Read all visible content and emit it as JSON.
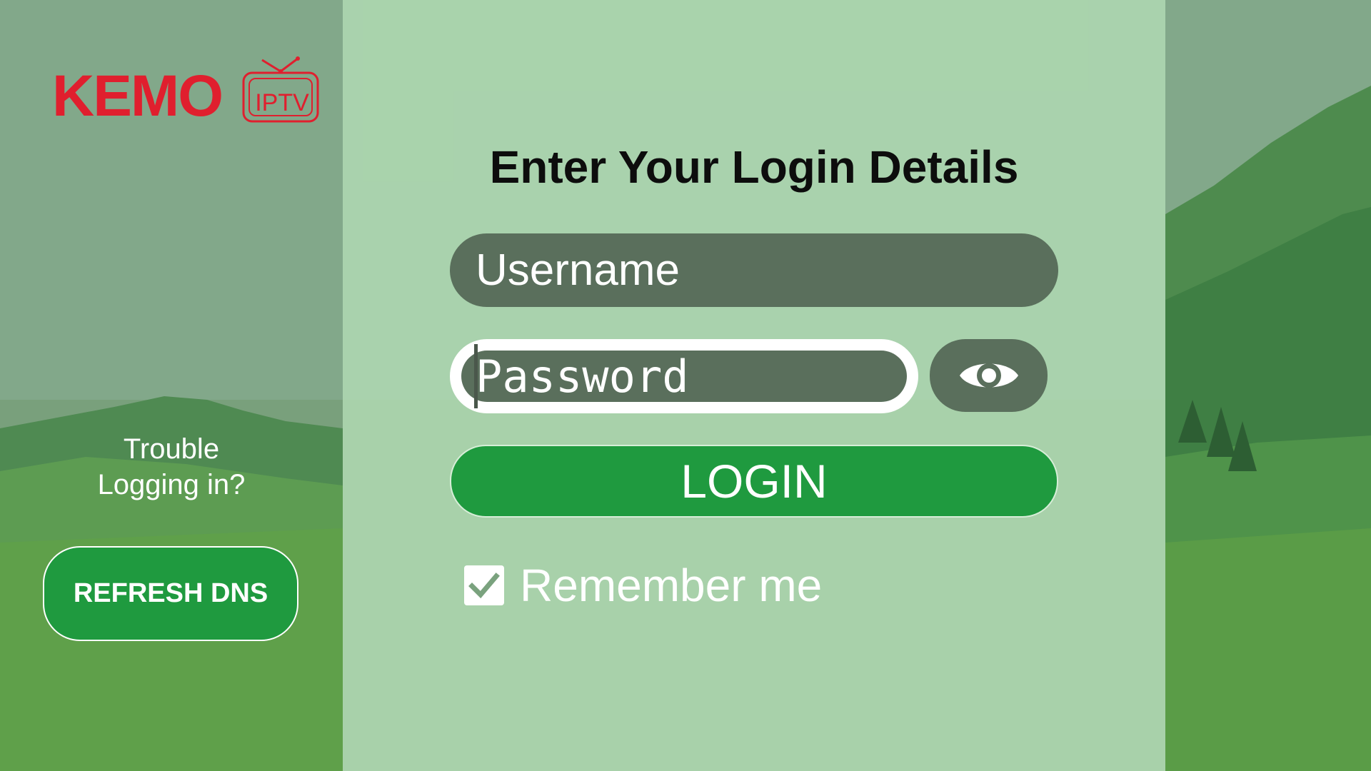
{
  "brand": {
    "name": "KEMO",
    "sub": "IPTV"
  },
  "sidebar": {
    "trouble_text": "Trouble Logging in?",
    "refresh_label": "REFRESH DNS"
  },
  "login": {
    "title": "Enter Your Login Details",
    "username_placeholder": "Username",
    "password_placeholder": "Password",
    "login_label": "LOGIN",
    "remember_label": "Remember me",
    "remember_checked": true
  },
  "icons": {
    "eye": "eye-icon",
    "check": "check-icon",
    "tv": "tv-icon"
  },
  "colors": {
    "brand_red": "#e01f2e",
    "accent_green": "#1f9a3f",
    "field_gray": "#5a6f5c",
    "panel_tint": "#b2dcb4"
  }
}
